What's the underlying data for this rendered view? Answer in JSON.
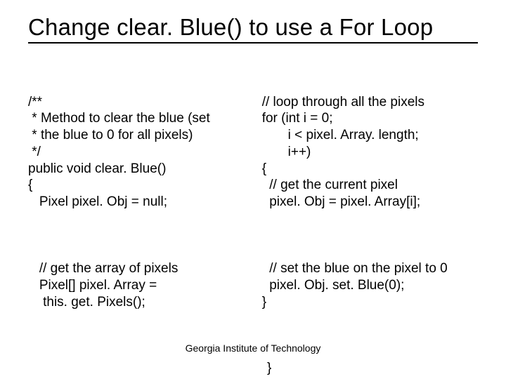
{
  "title": "Change clear. Blue() to use a For Loop",
  "left": {
    "block1": "/**\n * Method to clear the blue (set\n * the blue to 0 for all pixels)\n */\npublic void clear. Blue()\n{\n   Pixel pixel. Obj = null;",
    "block2": "   // get the array of pixels\n   Pixel[] pixel. Array =\n    this. get. Pixels();"
  },
  "right": {
    "block1": "// loop through all the pixels\nfor (int i = 0;\n       i < pixel. Array. length;\n       i++)\n{\n  // get the current pixel\n  pixel. Obj = pixel. Array[i];",
    "block2": "  // set the blue on the pixel to 0\n  pixel. Obj. set. Blue(0);\n}"
  },
  "closing": "}",
  "footer": "Georgia Institute of Technology"
}
